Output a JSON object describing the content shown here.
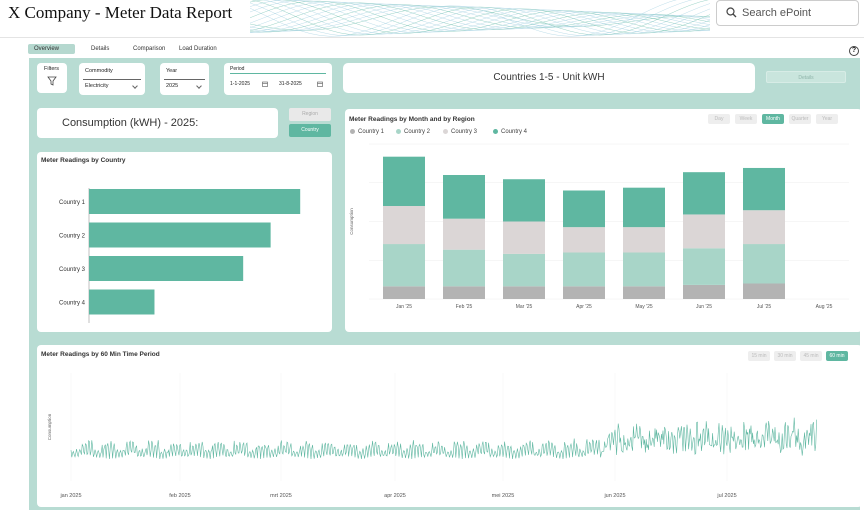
{
  "app": {
    "title": "X Company - Meter Data Report"
  },
  "search": {
    "placeholder": "Search ePoint"
  },
  "tabs": [
    {
      "label": "Overview",
      "active": true
    },
    {
      "label": "Details"
    },
    {
      "label": "Comparison"
    },
    {
      "label": "Load Duration"
    }
  ],
  "filters": {
    "label": "Filters",
    "commodity": {
      "label": "Commodity",
      "value": "Electricity"
    },
    "year": {
      "label": "Year",
      "value": "2025"
    },
    "period": {
      "label": "Period",
      "start": "1-1-2025",
      "end": "31-8-2025"
    }
  },
  "banner": {
    "text": "Countries 1-5 - Unit kWH"
  },
  "details_button": "Details",
  "consumption": {
    "text": "Consumption (kWH) - 2025:"
  },
  "toggle": {
    "region": "Region",
    "country": "Country"
  },
  "colors": {
    "accent": "#5fb7a1",
    "light_green": "#a8d5c8",
    "beige": "#dbd6d6",
    "grey": "#b3b3b3",
    "bg": "#b8dcd3"
  },
  "country_chart": {
    "title": "Meter Readings by Country",
    "chart_data": {
      "type": "bar",
      "orientation": "horizontal",
      "categories": [
        "Country 1",
        "Country 2",
        "Country 3",
        "Country 4"
      ],
      "values": [
        100,
        86,
        73,
        31
      ]
    }
  },
  "monthly_chart": {
    "title": "Meter Readings by Month and by Region",
    "ylabel": "Consumption",
    "view_buttons": [
      {
        "label": "Day"
      },
      {
        "label": "Week"
      },
      {
        "label": "Month",
        "active": true
      },
      {
        "label": "Quarter"
      },
      {
        "label": "Year"
      }
    ],
    "chart_data": {
      "type": "bar",
      "stacked": true,
      "categories": [
        "Jan '25",
        "Feb '25",
        "Mar '25",
        "Apr '25",
        "May '25",
        "Jun '25",
        "Jul '25",
        "Aug '25"
      ],
      "series": [
        {
          "name": "Country 1",
          "color": "#b3b3b3",
          "values": [
            9,
            9,
            9,
            9,
            9,
            10,
            11,
            0
          ]
        },
        {
          "name": "Country 2",
          "color": "#a8d5c8",
          "values": [
            30,
            26,
            23,
            24,
            24,
            26,
            28,
            0
          ]
        },
        {
          "name": "Country 3",
          "color": "#dbd6d6",
          "values": [
            27,
            22,
            23,
            18,
            18,
            24,
            24,
            0
          ]
        },
        {
          "name": "Country 4",
          "color": "#5fb7a1",
          "values": [
            35,
            31,
            30,
            26,
            28,
            30,
            30,
            0
          ]
        }
      ],
      "ylim": [
        0,
        110
      ]
    }
  },
  "timeseries_chart": {
    "title": "Meter Readings by 60 Min Time Period",
    "ylabel": "Consumption",
    "period_buttons": [
      {
        "label": "15 min"
      },
      {
        "label": "30 min"
      },
      {
        "label": "45 min"
      },
      {
        "label": "60 min",
        "active": true
      }
    ],
    "x_labels": [
      "jan 2025",
      "feb 2025",
      "mrt 2025",
      "apr 2025",
      "mei 2025",
      "jun 2025",
      "jul 2025"
    ]
  }
}
